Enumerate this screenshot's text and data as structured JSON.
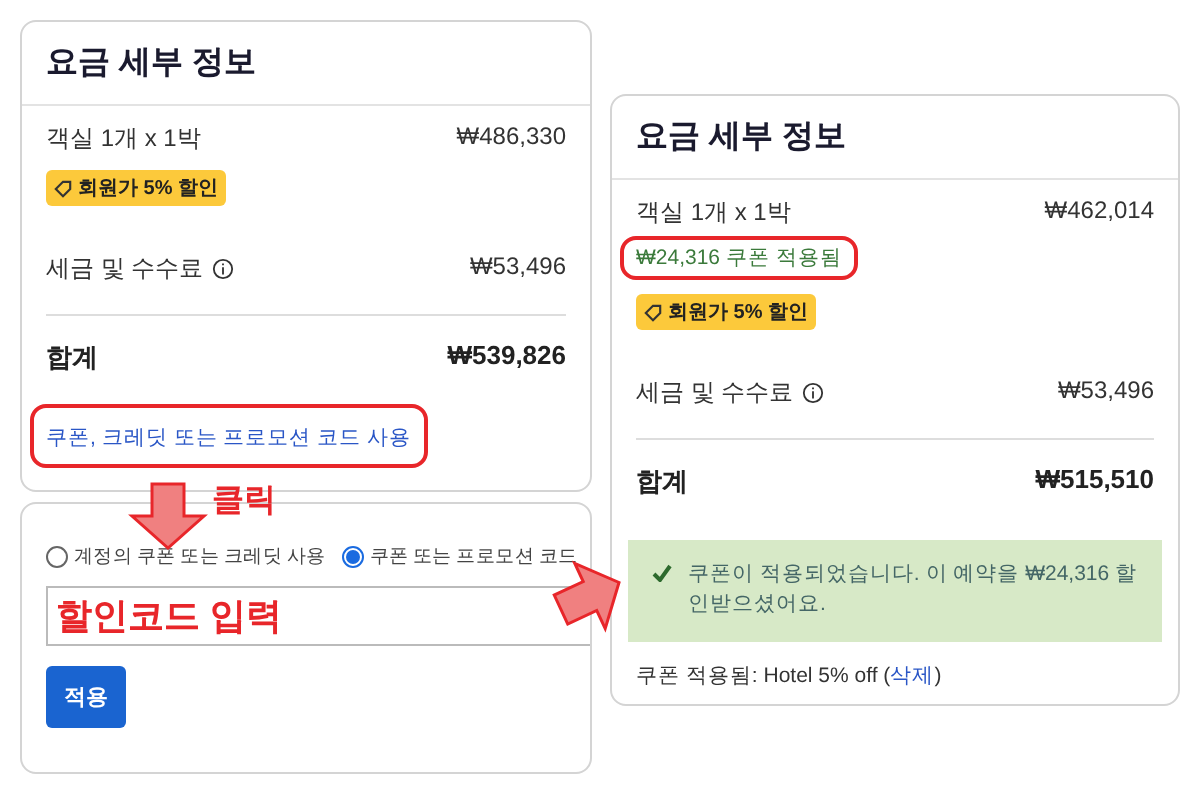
{
  "before": {
    "title": "요금 세부 정보",
    "lines": [
      {
        "label": "객실 1개 x 1박",
        "amount": "₩486,330",
        "badge": "회원가 5% 할인",
        "info": false
      },
      {
        "label": "세금 및 수수료",
        "amount": "₩53,496",
        "info": true
      }
    ],
    "total": {
      "label": "합계",
      "amount": "₩539,826"
    },
    "link": "쿠폰, 크레딧 또는 프로모션 코드 사용"
  },
  "coupon_form": {
    "options": [
      {
        "label": "계정의 쿠폰 또는 크레딧 사용",
        "selected": false
      },
      {
        "label": "쿠폰 또는 프로모션 코드",
        "selected": true
      }
    ],
    "button": "적용"
  },
  "after": {
    "title": "요금 세부 정보",
    "lines": [
      {
        "label": "객실 1개 x 1박",
        "amount": "₩462,014",
        "note": "₩24,316 쿠폰 적용됨",
        "badge": "회원가 5% 할인",
        "info": false
      },
      {
        "label": "세금 및 수수료",
        "amount": "₩53,496",
        "info": true
      }
    ],
    "total": {
      "label": "합계",
      "amount": "₩515,510"
    },
    "success": "쿠폰이 적용되었습니다. 이 예약을 ₩24,316 할인받으셨어요.",
    "footer": "쿠폰 적용됨: Hotel 5% off (",
    "footer_link": "삭제",
    "footer_end": ")"
  },
  "annotations": {
    "click_label": "클릭",
    "input_label": "할인코드 입력"
  }
}
